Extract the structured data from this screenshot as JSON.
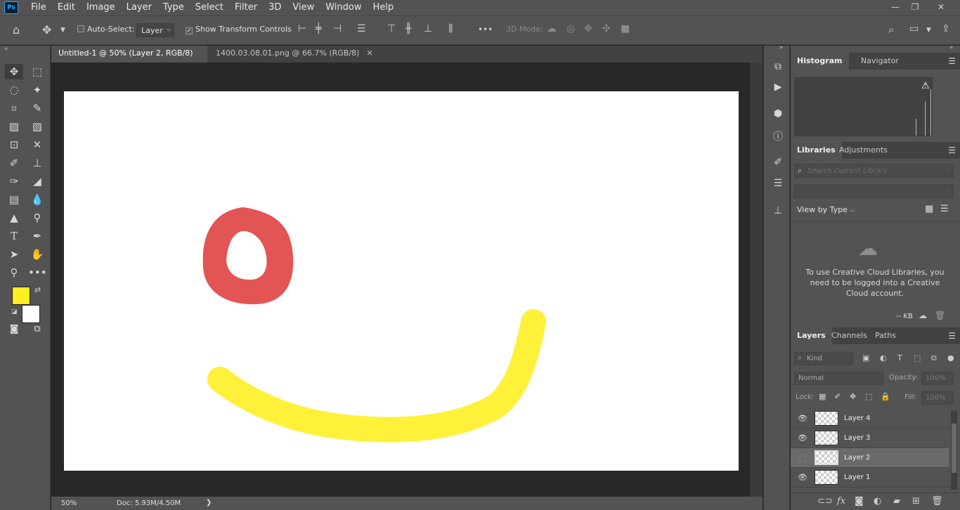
{
  "menu": {
    "app_logo": "Ps",
    "items": [
      "File",
      "Edit",
      "Image",
      "Layer",
      "Type",
      "Select",
      "Filter",
      "3D",
      "View",
      "Window",
      "Help"
    ],
    "window_controls": {
      "minimize": "—",
      "restore": "❐",
      "close": "✕"
    }
  },
  "options": {
    "auto_select_label": "Auto-Select:",
    "auto_select_checked": false,
    "auto_select_target": "Layer",
    "show_transform_label": "Show Transform Controls",
    "show_transform_checked": true,
    "more": "•••",
    "mode_3d_label": "3D Mode:"
  },
  "tabs": [
    {
      "title": "Untitled-1 @ 50% (Layer 2, RGB/8) *",
      "active": true
    },
    {
      "title": "1400.03.08.01.png @ 66.7% (RGB/8)",
      "active": false
    }
  ],
  "status": {
    "zoom": "50%",
    "doc": "Doc: 5.93M/4.50M",
    "arrow": "❯"
  },
  "colors": {
    "foreground": "#ffee22",
    "background": "#ffffff",
    "red_stroke": "#e35454",
    "yellow_stroke": "#fff03a"
  },
  "histogram": {
    "tab1": "Histogram",
    "tab2": "Navigator",
    "warning": "⚠"
  },
  "libraries": {
    "tab1": "Libraries",
    "tab2": "Adjustments",
    "search_placeholder": "Search Current Library",
    "view_by": "View by Type",
    "message": "To use Creative Cloud Libraries, you need to be logged into a Creative Cloud account.",
    "size": "-- KB"
  },
  "layers_panel": {
    "tab1": "Layers",
    "tab2": "Channels",
    "tab3": "Paths",
    "kind_label": "Kind",
    "blend_mode": "Normal",
    "opacity_label": "Opacity:",
    "opacity_value": "100%",
    "lock_label": "Lock:",
    "fill_label": "Fill:",
    "fill_value": "100%",
    "layers": [
      {
        "name": "Layer 4",
        "visible": true,
        "selected": false
      },
      {
        "name": "Layer 3",
        "visible": true,
        "selected": false
      },
      {
        "name": "Layer 2",
        "visible": false,
        "selected": true
      },
      {
        "name": "Layer 1",
        "visible": true,
        "selected": false
      }
    ]
  }
}
